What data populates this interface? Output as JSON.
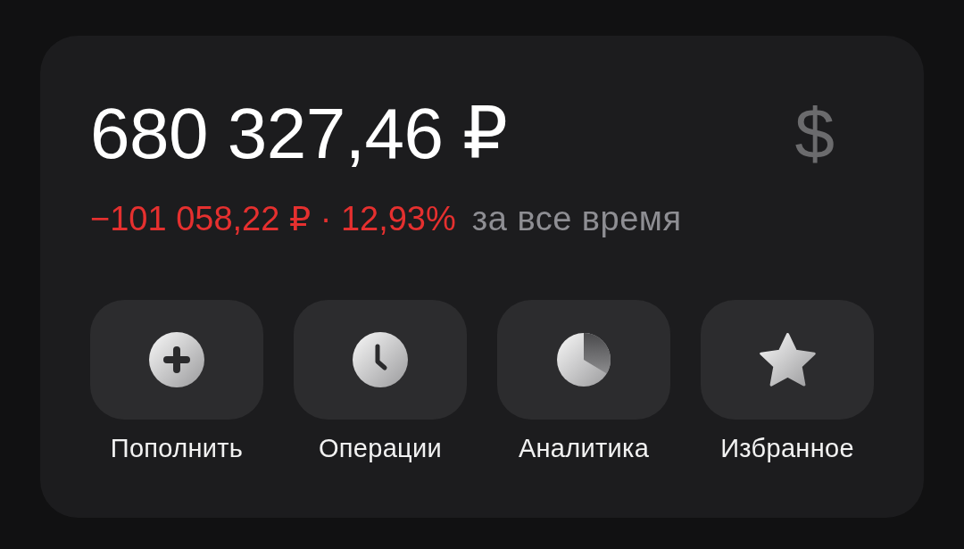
{
  "balance": {
    "amount": "680 327,46 ₽",
    "currency_button": "$"
  },
  "change": {
    "value": "−101 058,22 ₽ · 12,93%",
    "negative": true,
    "period": "за все время"
  },
  "actions": [
    {
      "kind": "plus",
      "label": "Пополнить"
    },
    {
      "kind": "clock",
      "label": "Операции"
    },
    {
      "kind": "pie",
      "label": "Аналитика"
    },
    {
      "kind": "star",
      "label": "Избранное"
    }
  ]
}
